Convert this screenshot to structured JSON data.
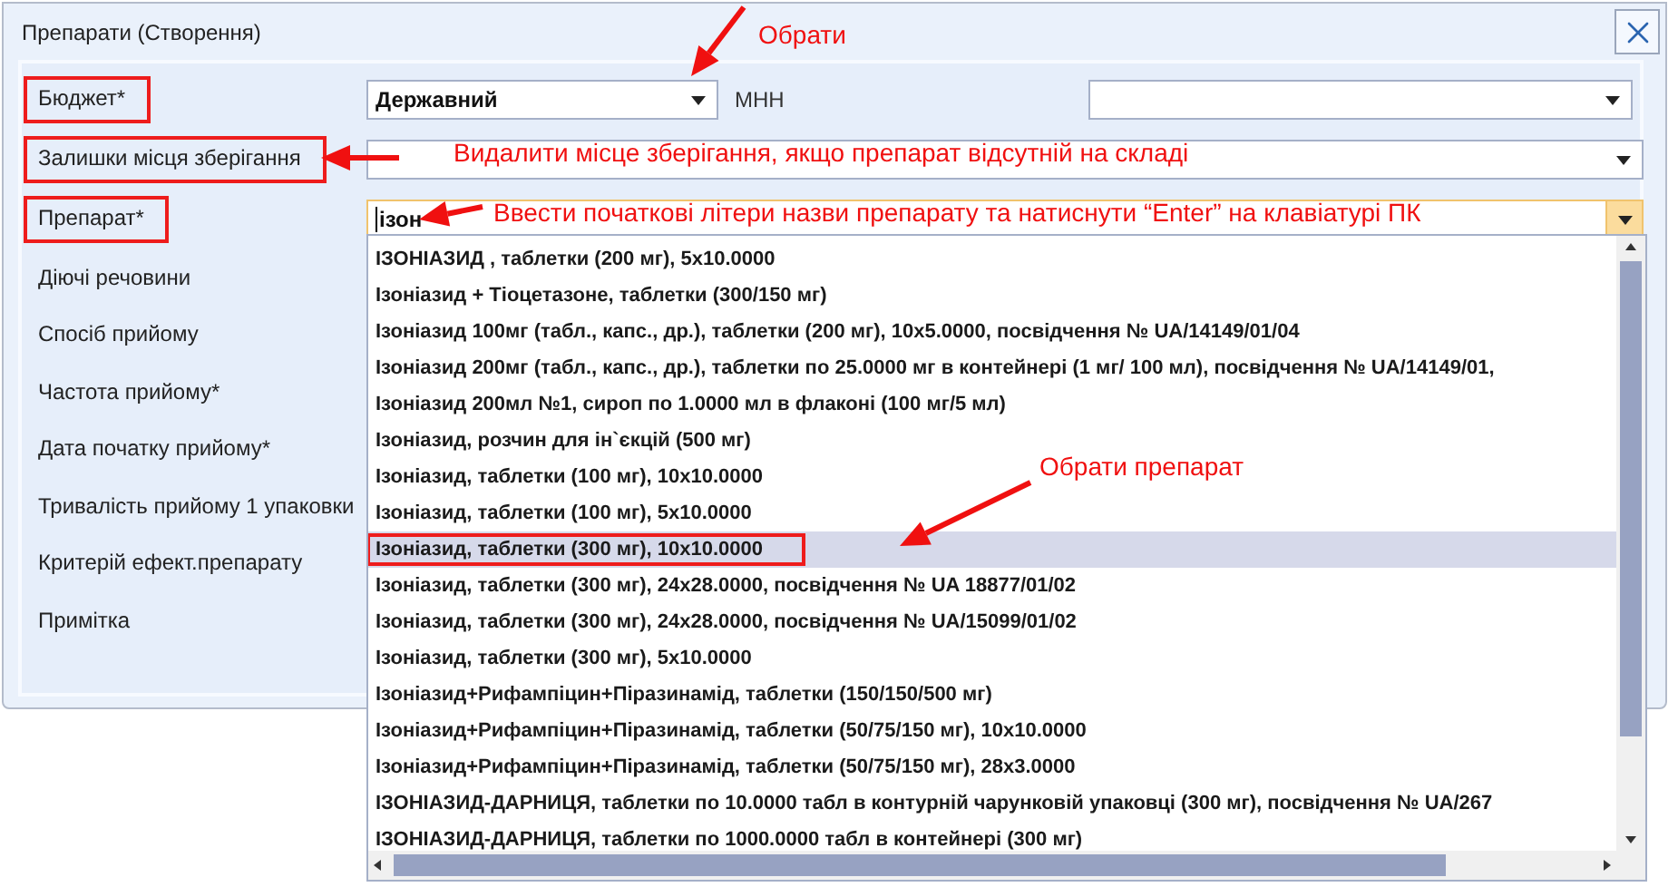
{
  "window": {
    "title": "Препарати (Створення)"
  },
  "form": {
    "fields": [
      {
        "label": "Бюджет*",
        "highlighted": true,
        "kind": "split",
        "value": "Державний",
        "extra_label": "МНН"
      },
      {
        "label": "Залишки місця зберігання",
        "highlighted": true,
        "kind": "combo"
      },
      {
        "label": "Препарат*",
        "highlighted": true,
        "kind": "search",
        "value": "ізон",
        "focused": true
      }
    ],
    "labels": [
      {
        "label": "Діючі речовини"
      },
      {
        "label": "Спосіб прийому"
      },
      {
        "label": "Частота прийому*"
      },
      {
        "label": "Дата початку прийому*"
      },
      {
        "label": "Тривалість прийому 1 упаковки"
      },
      {
        "label": "Критерій ефект.препарату"
      },
      {
        "label": "Примітка"
      }
    ]
  },
  "dropdown": {
    "items": [
      {
        "text": "ІЗОНІАЗИД , таблетки (200 мг), 5x10.0000",
        "selected": false,
        "marked": false
      },
      {
        "text": "Ізоніазид + Тіоцетазоне, таблетки (300/150 мг)",
        "selected": false,
        "marked": false
      },
      {
        "text": "Ізоніазид 100мг (табл., капс., др.), таблетки (200 мг), 10x5.0000, посвідчення № UA/14149/01/04",
        "selected": false,
        "marked": false
      },
      {
        "text": "Ізоніазид 200мг (табл., капс., др.), таблетки по 25.0000 мг в контейнері (1 мг/ 100 мл), посвідчення № UA/14149/01,",
        "selected": false,
        "marked": false
      },
      {
        "text": "Ізоніазид 200мл №1, сироп по 1.0000 мл в флаконі (100 мг/5 мл)",
        "selected": false,
        "marked": false
      },
      {
        "text": "Ізоніазид, розчин для ін`єкцій (500 мг)",
        "selected": false,
        "marked": false
      },
      {
        "text": "Ізоніазид, таблетки (100 мг), 10x10.0000",
        "selected": false,
        "marked": false
      },
      {
        "text": "Ізоніазид, таблетки (100 мг), 5x10.0000",
        "selected": false,
        "marked": false
      },
      {
        "text": "Ізоніазид, таблетки (300 мг), 10x10.0000",
        "selected": true,
        "marked": true
      },
      {
        "text": "Ізоніазид, таблетки (300 мг), 24x28.0000, посвідчення № UA 18877/01/02",
        "selected": false,
        "marked": false
      },
      {
        "text": "Ізоніазид, таблетки (300 мг), 24x28.0000, посвідчення № UA/15099/01/02",
        "selected": false,
        "marked": false
      },
      {
        "text": "Ізоніазид, таблетки (300 мг), 5x10.0000",
        "selected": false,
        "marked": false
      },
      {
        "text": "Ізоніазид+Рифампіцин+Піразинамід, таблетки (150/150/500 мг)",
        "selected": false,
        "marked": false
      },
      {
        "text": "Ізоніазид+Рифампіцин+Піразинамід, таблетки (50/75/150 мг), 10x10.0000",
        "selected": false,
        "marked": false
      },
      {
        "text": "Ізоніазид+Рифампіцин+Піразинамід, таблетки (50/75/150 мг), 28x3.0000",
        "selected": false,
        "marked": false
      },
      {
        "text": "ІЗОНІАЗИД-ДАРНИЦЯ, таблетки по 10.0000 табл в контурній чарунковій упаковці (300 мг), посвідчення № UA/267",
        "selected": false,
        "marked": false
      },
      {
        "text": "ІЗОНІАЗИД-ДАРНИЦЯ, таблетки по 1000.0000 табл в контейнері (300 мг)",
        "selected": false,
        "marked": false
      }
    ]
  },
  "annotations": [
    {
      "text": "Обрати"
    },
    {
      "text": "Видалити місце зберігання, якщо препарат відсутній на складі"
    },
    {
      "text": "Ввести початкові літери назви препарату та натиснути “Enter” на клавіатурі ПК"
    },
    {
      "text": "Обрати препарат"
    }
  ]
}
